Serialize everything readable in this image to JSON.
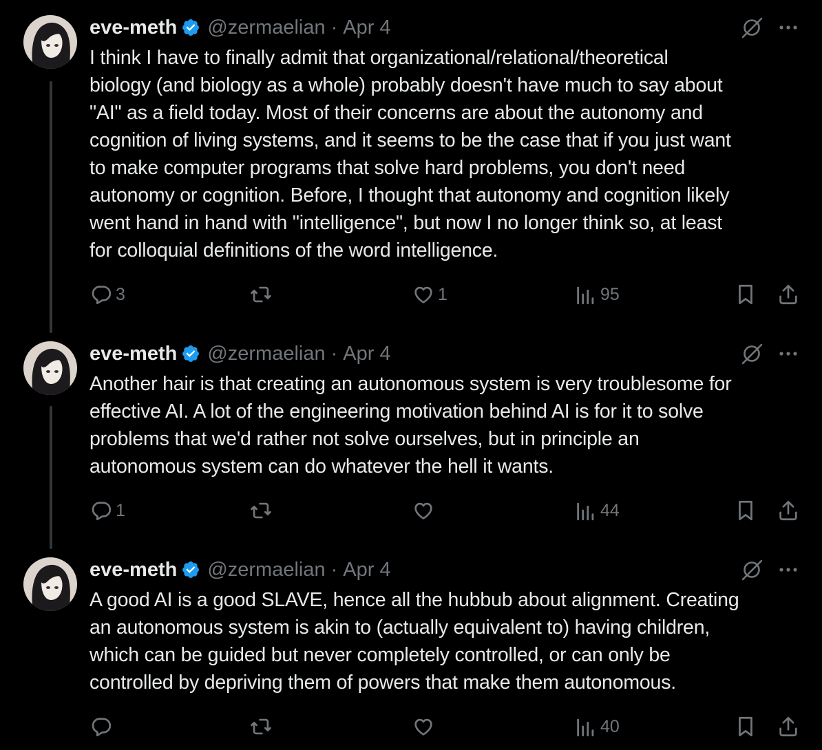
{
  "tweets": [
    {
      "name": "eve-meth",
      "handle": "@zermaelian",
      "separator": "·",
      "date": "Apr 4",
      "text": "I think I have to finally admit that organizational/relational/theoretical\nbiology (and biology as a whole) probably doesn't have much to say about\n\"AI\" as a field today. Most of their concerns are about the autonomy and\ncognition of living systems, and it seems to be the case that if you just want\nto make computer programs that solve hard problems, you don't need\nautonomy or cognition. Before, I thought that autonomy and cognition likely\nwent hand in hand with \"intelligence\", but now I no longer think so, at least\nfor colloquial definitions of the word intelligence.",
      "replies": "3",
      "reposts": "",
      "likes": "1",
      "views": "95"
    },
    {
      "name": "eve-meth",
      "handle": "@zermaelian",
      "separator": "·",
      "date": "Apr 4",
      "text": "Another hair is that creating an autonomous system is very troublesome for\neffective AI. A lot of the engineering motivation behind AI is for it to solve\nproblems that we'd rather not solve ourselves, but in principle an\nautonomous system can do whatever the hell it wants.",
      "replies": "1",
      "reposts": "",
      "likes": "",
      "views": "44"
    },
    {
      "name": "eve-meth",
      "handle": "@zermaelian",
      "separator": "·",
      "date": "Apr 4",
      "text": "A good AI is a good SLAVE, hence all the hubbub about alignment. Creating\nan autonomous system is akin to (actually equivalent to) having children,\nwhich can be guided but never completely controlled, or can only be\ncontrolled by depriving them of powers that make them autonomous.",
      "replies": "",
      "reposts": "",
      "likes": "",
      "views": "40"
    }
  ],
  "icons": {
    "verified": "verified-badge-icon",
    "grok": "grok-icon",
    "more": "more-icon",
    "reply": "reply-icon",
    "repost": "repost-icon",
    "like": "like-icon",
    "views": "views-icon",
    "bookmark": "bookmark-icon",
    "share": "share-icon"
  },
  "colors": {
    "background": "#000000",
    "text": "#e7e9ea",
    "muted": "#71767b",
    "verified": "#1d9bf0",
    "thread_line": "#333639"
  }
}
